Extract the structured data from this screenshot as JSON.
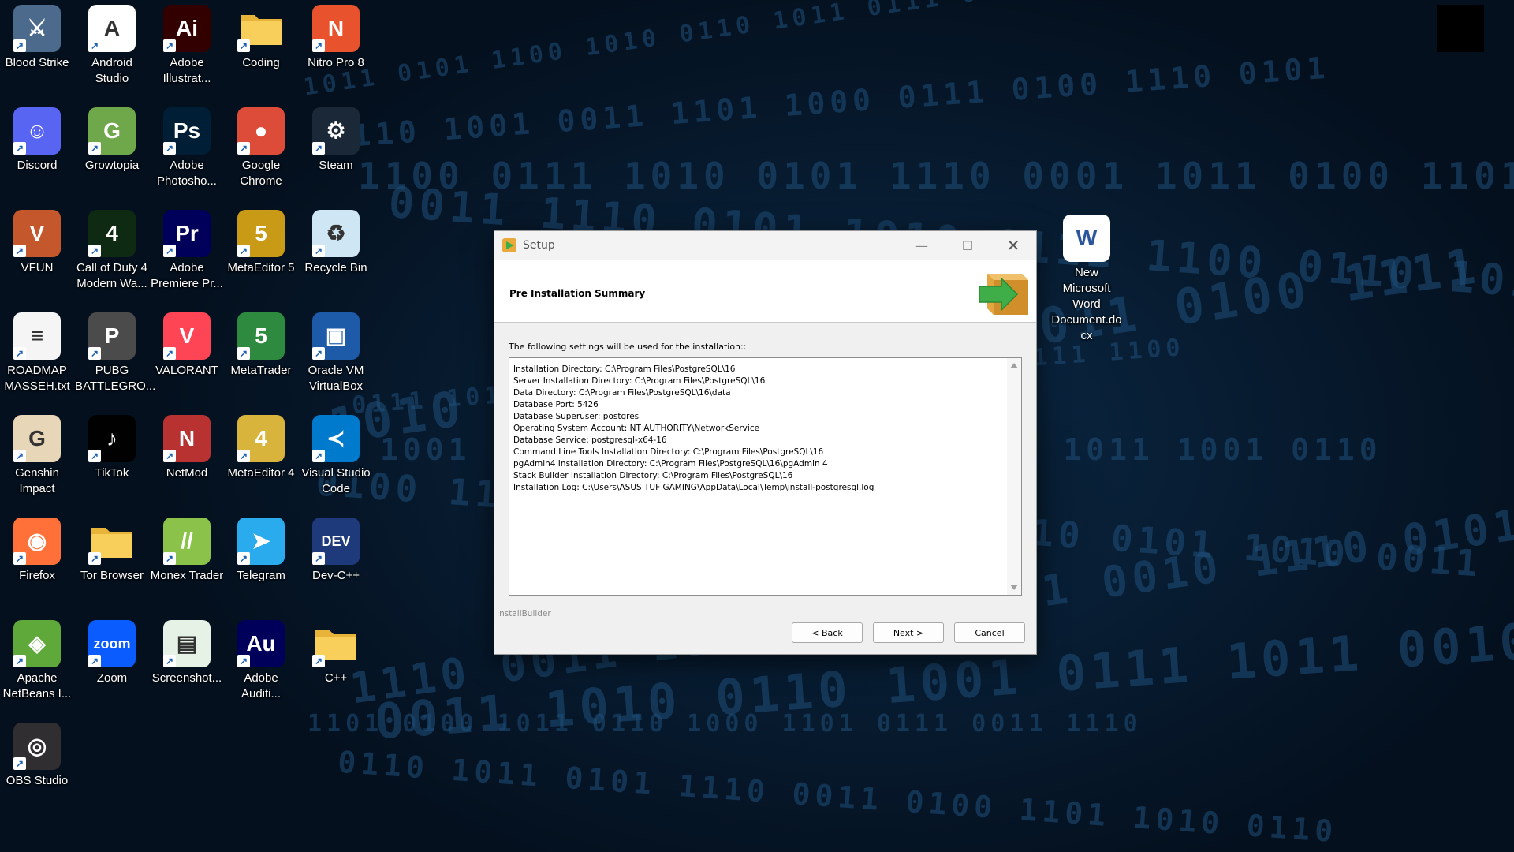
{
  "desktop": {
    "icons": [
      {
        "label": "Blood Strike",
        "icon": "blood-strike-icon",
        "color": "#4b6a8c",
        "glyph": "⚔"
      },
      {
        "label": "Android Studio",
        "icon": "android-studio-icon",
        "color": "#ffffff",
        "glyph": "A"
      },
      {
        "label": "Adobe Illustrat...",
        "icon": "adobe-illustrator-icon",
        "color": "#330000",
        "glyph": "Ai"
      },
      {
        "label": "Coding",
        "icon": "folder-icon",
        "color": "#f2c94c",
        "glyph": ""
      },
      {
        "label": "Nitro Pro 8",
        "icon": "nitro-pro-icon",
        "color": "#e8522c",
        "glyph": "N"
      },
      {
        "label": "Discord",
        "icon": "discord-icon",
        "color": "#5865f2",
        "glyph": "☺"
      },
      {
        "label": "Growtopia",
        "icon": "growtopia-icon",
        "color": "#6fa84a",
        "glyph": "G"
      },
      {
        "label": "Adobe Photosho...",
        "icon": "adobe-photoshop-icon",
        "color": "#001e36",
        "glyph": "Ps"
      },
      {
        "label": "Google Chrome",
        "icon": "chrome-icon",
        "color": "#dd4b39",
        "glyph": "●"
      },
      {
        "label": "Steam",
        "icon": "steam-icon",
        "color": "#1b2838",
        "glyph": "⚙"
      },
      {
        "label": "VFUN",
        "icon": "vfun-icon",
        "color": "#c4572c",
        "glyph": "V"
      },
      {
        "label": "Call of Duty 4 Modern Wa...",
        "icon": "call-of-duty-icon",
        "color": "#0f2a12",
        "glyph": "4"
      },
      {
        "label": "Adobe Premiere Pr...",
        "icon": "adobe-premiere-icon",
        "color": "#00005b",
        "glyph": "Pr"
      },
      {
        "label": "MetaEditor 5",
        "icon": "metaeditor-5-icon",
        "color": "#c99a16",
        "glyph": "5"
      },
      {
        "label": "Recycle Bin",
        "icon": "recycle-bin-icon",
        "color": "#cfe6f5",
        "glyph": "♻"
      },
      {
        "label": "ROADMAP MASSEH.txt",
        "icon": "text-file-icon",
        "color": "#f5f5f5",
        "glyph": "≡"
      },
      {
        "label": "PUBG BATTLEGRO...",
        "icon": "pubg-icon",
        "color": "#4b4b4b",
        "glyph": "P"
      },
      {
        "label": "VALORANT",
        "icon": "valorant-icon",
        "color": "#fd4556",
        "glyph": "V"
      },
      {
        "label": "MetaTrader",
        "icon": "metatrader-icon",
        "color": "#2d8a3e",
        "glyph": "5"
      },
      {
        "label": "Oracle VM VirtualBox",
        "icon": "virtualbox-icon",
        "color": "#1d5aa8",
        "glyph": "▣"
      },
      {
        "label": "Genshin Impact",
        "icon": "genshin-impact-icon",
        "color": "#e8d6b8",
        "glyph": "G"
      },
      {
        "label": "TikTok",
        "icon": "tiktok-icon",
        "color": "#010101",
        "glyph": "♪"
      },
      {
        "label": "NetMod",
        "icon": "netmod-icon",
        "color": "#b83232",
        "glyph": "N"
      },
      {
        "label": "MetaEditor 4",
        "icon": "metaeditor-4-icon",
        "color": "#d9b43c",
        "glyph": "4"
      },
      {
        "label": "Visual Studio Code",
        "icon": "vscode-icon",
        "color": "#007acc",
        "glyph": "≺"
      },
      {
        "label": "Firefox",
        "icon": "firefox-icon",
        "color": "#ff7139",
        "glyph": "◉"
      },
      {
        "label": "Tor Browser",
        "icon": "folder-icon",
        "color": "#f2c94c",
        "glyph": ""
      },
      {
        "label": "Monex Trader",
        "icon": "monex-trader-icon",
        "color": "#8bc34a",
        "glyph": "//"
      },
      {
        "label": "Telegram",
        "icon": "telegram-icon",
        "color": "#2aabee",
        "glyph": "➤"
      },
      {
        "label": "Dev-C++",
        "icon": "dev-cpp-icon",
        "color": "#1f3a7a",
        "glyph": "DEV"
      },
      {
        "label": "Apache NetBeans I...",
        "icon": "netbeans-icon",
        "color": "#5fa83a",
        "glyph": "◈"
      },
      {
        "label": "Zoom",
        "icon": "zoom-icon",
        "color": "#0b5cff",
        "glyph": "zoom"
      },
      {
        "label": "Screenshot...",
        "icon": "screenshot-file-icon",
        "color": "#e6f2e6",
        "glyph": "▤"
      },
      {
        "label": "Adobe Auditi...",
        "icon": "adobe-audition-icon",
        "color": "#00005b",
        "glyph": "Au"
      },
      {
        "label": "C++",
        "icon": "folder-icon",
        "color": "#f2c94c",
        "glyph": ""
      },
      {
        "label": "OBS Studio",
        "icon": "obs-studio-icon",
        "color": "#302e31",
        "glyph": "◎"
      }
    ],
    "word_doc": {
      "label": "New Microsoft Word Document.do cx",
      "icon": "word-document-icon",
      "color": "#2b579a",
      "glyph": "W"
    }
  },
  "window": {
    "title": "Setup",
    "header_title": "Pre Installation Summary",
    "intro": "The following settings will be used for the installation::",
    "summary": [
      "Installation Directory: C:\\Program Files\\PostgreSQL\\16",
      "Server Installation Directory: C:\\Program Files\\PostgreSQL\\16",
      "Data Directory: C:\\Program Files\\PostgreSQL\\16\\data",
      "Database Port: 5426",
      "Database Superuser: postgres",
      "Operating System Account: NT AUTHORITY\\NetworkService",
      "Database Service: postgresql-x64-16",
      "Command Line Tools Installation Directory: C:\\Program Files\\PostgreSQL\\16",
      "pgAdmin4 Installation Directory: C:\\Program Files\\PostgreSQL\\16\\pgAdmin 4",
      "Stack Builder Installation Directory: C:\\Program Files\\PostgreSQL\\16",
      "Installation Log: C:\\Users\\ASUS TUF GAMING\\AppData\\Local\\Temp\\install-postgresql.log"
    ],
    "brand": "InstallBuilder",
    "buttons": {
      "back": "< Back",
      "next": "Next >",
      "cancel": "Cancel"
    },
    "controls": {
      "minimize": "—",
      "maximize": "☐",
      "close": "✕"
    }
  },
  "background_digits": [
    "1011 0101 1100 1010 0110 1011 0111 0001 1010",
    "0110 1001 0011 1101 1000 0111 0100 1110 0101",
    "1100 0111 1010 0101 1110 0001 1011 0100 1101",
    "0011 1110 0101 1010 0111 1100 0110 1011 0010",
    "1010 0001 1101 0110 1011 0100 1111 0010 1001",
    "0111 1010 0010 1101 0100 1011 1000 0111 1100",
    "1001 0110 1011 0011 1100 0110 1011 1001 0110",
    "0100 1101 0110 1010 0011 1110 0101 1010 0011",
    "1110 0011 1001 0110 1101 0010 1110 0101 1010",
    "0011 1010 0110 1001 0111 1011 0010 1110 0101",
    "1101 0100 1011 0110 1000 1101 0111 0011 1110",
    "0110 1011 0101 1110 0011 0100 1101 1010 0110"
  ]
}
